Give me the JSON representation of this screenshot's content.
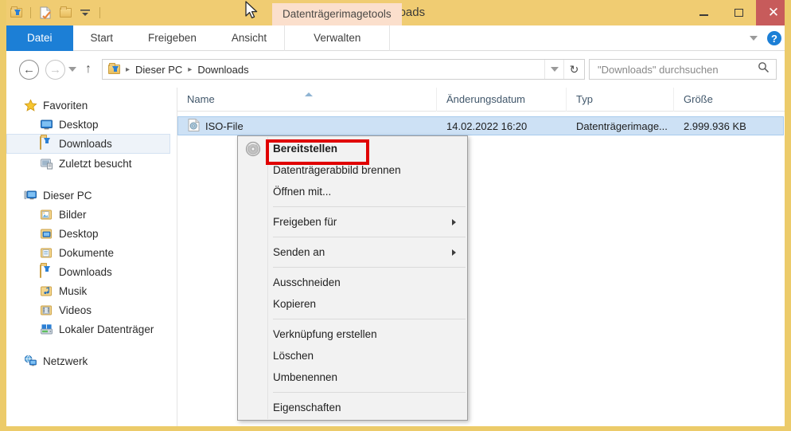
{
  "window": {
    "title": "Downloads",
    "accent_titlebar": "#f0cc72",
    "accent_close": "#c75b5b",
    "contextual_tab_label": "Datenträgerimagetools",
    "contextual_tab_bg": "#fbdfcc",
    "minimize_label": "Minimieren",
    "maximize_label": "Maximieren",
    "close_label": "Schließen"
  },
  "quick_access": {
    "items": [
      {
        "name": "downloads-folder-icon",
        "label": "Downloads"
      },
      {
        "name": "new-item-icon",
        "label": "Neues Element"
      },
      {
        "name": "new-folder-icon",
        "label": "Neuer Ordner"
      },
      {
        "name": "customize-qat-icon",
        "label": "Symbolleiste für den Schnellzugriff anpassen"
      }
    ]
  },
  "ribbon": {
    "tabs": [
      {
        "label": "Datei",
        "active": true
      },
      {
        "label": "Start",
        "active": false
      },
      {
        "label": "Freigeben",
        "active": false
      },
      {
        "label": "Ansicht",
        "active": false
      },
      {
        "label": "Verwalten",
        "active": false,
        "contextual": true
      }
    ],
    "collapse_label": "Menüband minimieren",
    "help_label": "?"
  },
  "address_bar": {
    "back_label": "Zurück",
    "forward_label": "Vorwärts",
    "recent_label": "Zuletzt besuchte Orte",
    "up_label": "Eine Ebene nach oben",
    "crumbs": [
      "Dieser PC",
      "Downloads"
    ],
    "crumb_separator": "▸",
    "dropdown_label": "Vorherige Orte",
    "refresh_label": "Aktualisieren",
    "refresh_glyph": "↻"
  },
  "search": {
    "placeholder": "\"Downloads\" durchsuchen",
    "icon_label": "search-icon"
  },
  "nav_pane": {
    "groups": [
      {
        "header": {
          "label": "Favoriten",
          "icon": "star-icon"
        },
        "items": [
          {
            "label": "Desktop",
            "icon": "desktop-icon",
            "selected": false
          },
          {
            "label": "Downloads",
            "icon": "downloads-folder-icon",
            "selected": true
          },
          {
            "label": "Zuletzt besucht",
            "icon": "recent-places-icon",
            "selected": false
          }
        ]
      },
      {
        "header": {
          "label": "Dieser PC",
          "icon": "this-pc-icon"
        },
        "items": [
          {
            "label": "Bilder",
            "icon": "pictures-folder-icon",
            "selected": false
          },
          {
            "label": "Desktop",
            "icon": "desktop-folder-icon",
            "selected": false
          },
          {
            "label": "Dokumente",
            "icon": "documents-folder-icon",
            "selected": false
          },
          {
            "label": "Downloads",
            "icon": "downloads-folder-icon",
            "selected": false
          },
          {
            "label": "Musik",
            "icon": "music-folder-icon",
            "selected": false
          },
          {
            "label": "Videos",
            "icon": "videos-folder-icon",
            "selected": false
          },
          {
            "label": "Lokaler Datenträger",
            "icon": "local-disk-icon",
            "selected": false
          }
        ]
      },
      {
        "header": {
          "label": "Netzwerk",
          "icon": "network-icon"
        },
        "items": []
      }
    ]
  },
  "file_list": {
    "columns": [
      {
        "label": "Name",
        "sorted": true,
        "sort_dir": "asc"
      },
      {
        "label": "Änderungsdatum",
        "sorted": false
      },
      {
        "label": "Typ",
        "sorted": false
      },
      {
        "label": "Größe",
        "sorted": false
      }
    ],
    "rows": [
      {
        "icon": "iso-disc-icon",
        "name": "ISO-File",
        "date": "14.02.2022 16:20",
        "type": "Datenträgerimage...",
        "size": "2.999.936 KB",
        "selected": true
      }
    ]
  },
  "context_menu": {
    "header_icon": "disc-icon",
    "highlight_color": "#e00000",
    "items": [
      {
        "label": "Bereitstellen",
        "bold": true,
        "submenu": false,
        "highlighted": true
      },
      {
        "label": "Datenträgerabbild brennen",
        "bold": false,
        "submenu": false
      },
      {
        "label": "Öffnen mit...",
        "bold": false,
        "submenu": false
      },
      {
        "separator": true
      },
      {
        "label": "Freigeben für",
        "bold": false,
        "submenu": true
      },
      {
        "separator": true
      },
      {
        "label": "Senden an",
        "bold": false,
        "submenu": true
      },
      {
        "separator": true
      },
      {
        "label": "Ausschneiden",
        "bold": false,
        "submenu": false
      },
      {
        "label": "Kopieren",
        "bold": false,
        "submenu": false
      },
      {
        "separator": true
      },
      {
        "label": "Verknüpfung erstellen",
        "bold": false,
        "submenu": false
      },
      {
        "label": "Löschen",
        "bold": false,
        "submenu": false
      },
      {
        "label": "Umbenennen",
        "bold": false,
        "submenu": false
      },
      {
        "separator": true
      },
      {
        "label": "Eigenschaften",
        "bold": false,
        "submenu": false
      }
    ]
  }
}
